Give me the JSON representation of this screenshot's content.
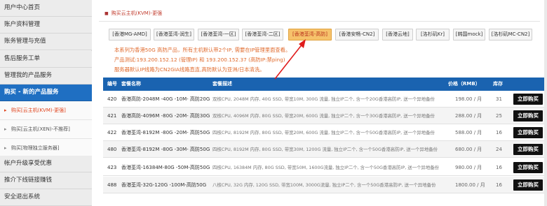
{
  "sidebar": {
    "items": [
      {
        "label": "用户中心首页"
      },
      {
        "label": "账户资料管理"
      },
      {
        "label": "账务管理与充值"
      },
      {
        "label": "售后服务工单"
      },
      {
        "label": "管理我的产品服务"
      },
      {
        "label": "购买 - 新的产品服务"
      }
    ],
    "subitems": [
      {
        "label": "购买[云主机(KVM)-更强]"
      },
      {
        "label": "购买[云主机(XEN)-不推荐]"
      },
      {
        "label": "购买[物理独立服务器]"
      }
    ],
    "bottom": [
      {
        "label": "帐户升级享受优惠"
      },
      {
        "label": "推介下线链接赚钱"
      },
      {
        "label": "安全退出系统"
      }
    ],
    "arrow_glyph": "▸"
  },
  "panel": {
    "title": "购买云主机(KVM)-更强",
    "title_icon": "square-bullet-icon"
  },
  "tabs": [
    {
      "label": "[香港MG-AMD]"
    },
    {
      "label": "[香港荃湾-润生]"
    },
    {
      "label": "[香港荃湾-一区]"
    },
    {
      "label": "[香港荃湾-二区]"
    },
    {
      "label": "[香港荃湾-高防]"
    },
    {
      "label": "[香港安畅-CN2]"
    },
    {
      "label": "[香港云地]"
    },
    {
      "label": "[洛杉矶Kr]"
    },
    {
      "label": "[韩国mock]"
    },
    {
      "label": "[洛杉矶MC-CN2]"
    }
  ],
  "notes": [
    "本系列为香港50G 高防产品，所有主机默认带2个IP, 需要在IP管理里面查看。",
    "产品测试:193.200.152.12 (管理IP) 和 193.200.152.37 (高防IP:禁ping)",
    "服务器默认IP线路为CN2GIA线路直连,高防默认为亚洲/日本清洗。"
  ],
  "table": {
    "headers": {
      "id": "编号",
      "name": "套餐名称",
      "desc": "套餐描述",
      "price": "价格（RMB）",
      "stock": "库存"
    },
    "buy_label": "立即购买",
    "rows": [
      {
        "id": "420",
        "name": "香港高防-2048M -40G -10M- 高防20G",
        "desc": "双核CPU, 2048M 内存, 40G SSD, 带宽10M, 300G 流量, 独立IP二个, 含一个20G香港高防IP, 送一个异地备份",
        "price": "198.00 / 月",
        "stock": "31"
      },
      {
        "id": "421",
        "name": "香港高防-4096M -80G -20M- 高防30G",
        "desc": "双核CPU, 4096M 内存, 80G SSD, 带宽20M, 600G 流量, 独立IP二个, 含一个30G香港高防IP, 送一个异地备份",
        "price": "288.00 / 月",
        "stock": "25"
      },
      {
        "id": "422",
        "name": "香港荃湾-8192M -80G -20M- 高防50G",
        "desc": "四核CPU, 8192M 内存, 80G SSD, 带宽20M, 600G 流量, 独立IP二个, 含一个50G香港高防IP, 送一个异地备份",
        "price": "588.00 / 月",
        "stock": "16"
      },
      {
        "id": "480",
        "name": "香港荃湾-8192M -80G -30M- 高防50G",
        "desc": "四核CPU, 8192M 内存, 80G SSD, 带宽30M, 1200G 流量, 独立IP二个, 含一个50G香港高防IP, 送一个异地备份",
        "price": "680.00 / 月",
        "stock": "24"
      },
      {
        "id": "423",
        "name": "香港荃湾-16384M-80G -50M-高防50G",
        "desc": "四核CPU, 16384M 内存, 80G SSD, 带宽50M, 1600G流量, 独立IP二个, 含一个50G香港高防IP, 送一个异地备份",
        "price": "980.00 / 月",
        "stock": "16"
      },
      {
        "id": "488",
        "name": "香港荃湾-32G-120G -100M-高防50G",
        "desc": "八核CPU, 32G 内存, 120G SSD, 带宽100M, 3000G流量, 独立IP二个, 含一个50G香港高防IP, 送一个异地备份",
        "price": "1800.00 / 月",
        "stock": "16"
      }
    ]
  },
  "colors": {
    "accent": "#1a63b0",
    "active_tab": "#f6c26b",
    "note_text": "#e06a2c",
    "annotation_arrow": "#e01b1b"
  }
}
